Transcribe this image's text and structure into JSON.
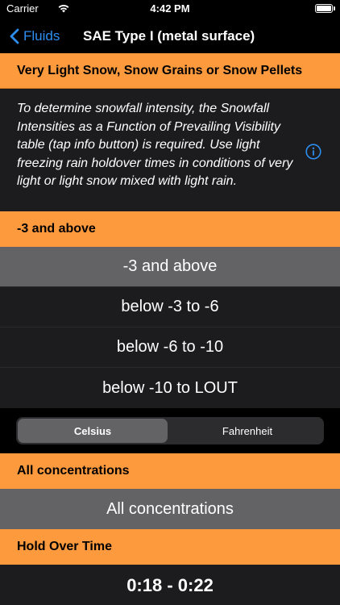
{
  "status_bar": {
    "carrier": "Carrier",
    "time": "4:42 PM"
  },
  "nav": {
    "back_label": "Fluids",
    "title": "SAE Type I (metal surface)"
  },
  "precip_header": "Very Light Snow, Snow Grains or Snow Pellets",
  "info_text": "To determine snowfall intensity, the Snowfall Intensities as a Function of Prevailing Visibility table (tap info button) is required. Use light freezing rain holdover times in conditions of very light or light snow mixed with light rain.",
  "temp_header": "-3 and above",
  "temp_options": [
    {
      "label": "-3 and above",
      "selected": true
    },
    {
      "label": "below -3 to -6",
      "selected": false
    },
    {
      "label": "below -6 to -10",
      "selected": false
    },
    {
      "label": "below -10 to LOUT",
      "selected": false
    }
  ],
  "units": {
    "options": [
      "Celsius",
      "Fahrenheit"
    ],
    "selected": "Celsius"
  },
  "concentration_header": "All concentrations",
  "concentration_option": "All concentrations",
  "hot_header": "Hold Over Time",
  "hot_value": "0:18 - 0:22",
  "colors": {
    "accent_orange": "#fe9a3e",
    "link_blue": "#2d8ef0",
    "selected_row": "#636366",
    "panel_bg": "#1c1c1e"
  }
}
